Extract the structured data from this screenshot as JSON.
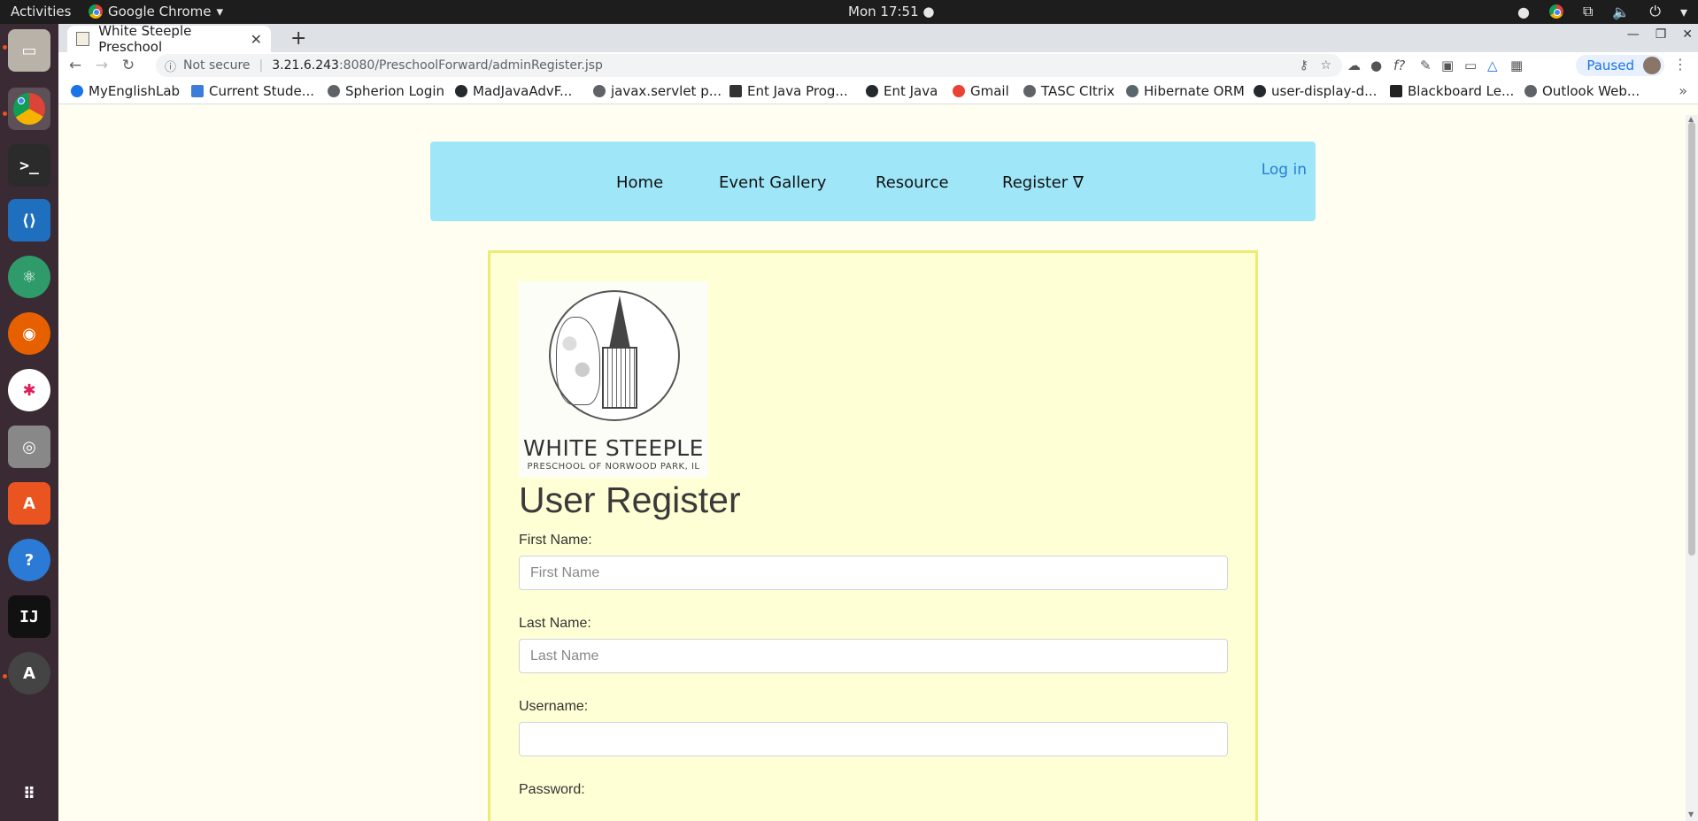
{
  "os_topbar": {
    "activities": "Activities",
    "app_name": "Google Chrome",
    "clock": "Mon 17:51"
  },
  "browser": {
    "tab_title": "White Steeple Preschool",
    "address": {
      "security_label": "Not secure",
      "host": "3.21.6.243",
      "path": ":8080/PreschoolForward/adminRegister.jsp"
    },
    "profile_status": "Paused",
    "bookmarks": [
      {
        "label": "MyEnglishLab",
        "color": "#1a73e8"
      },
      {
        "label": "Current Stude...",
        "color": "#3b7dd8"
      },
      {
        "label": "Spherion Login",
        "color": "#5f6368"
      },
      {
        "label": "MadJavaAdvF...",
        "color": "#24292e"
      },
      {
        "label": "javax.servlet p...",
        "color": "#5f6368"
      },
      {
        "label": "Ent Java Prog...",
        "color": "#333333"
      },
      {
        "label": "Ent Java",
        "color": "#24292e"
      },
      {
        "label": "Gmail",
        "color": "#ea4335"
      },
      {
        "label": "TASC CItrix",
        "color": "#5f6368"
      },
      {
        "label": "Hibernate ORM",
        "color": "#59666c"
      },
      {
        "label": "user-display-d...",
        "color": "#24292e"
      },
      {
        "label": "Blackboard Le...",
        "color": "#222222"
      },
      {
        "label": "Outlook Web...",
        "color": "#5f6368"
      }
    ]
  },
  "page": {
    "nav": {
      "home": "Home",
      "event_gallery": "Event Gallery",
      "resource": "Resource",
      "register": "Register ∇",
      "login": "Log in"
    },
    "logo": {
      "name": "WHITE STEEPLE",
      "subtitle": "PRESCHOOL OF NORWOOD PARK, IL"
    },
    "form": {
      "title": "User Register",
      "first_name_label": "First Name:",
      "first_name_placeholder": "First Name",
      "last_name_label": "Last Name:",
      "last_name_placeholder": "Last Name",
      "username_label": "Username:",
      "password_label": "Password:"
    }
  },
  "colors": {
    "navbar_bg": "#9fe7f8",
    "card_border": "#ecec6e",
    "card_bg": "#ffffd6",
    "page_bg": "#fffef0",
    "link": "#2a7ad6"
  }
}
